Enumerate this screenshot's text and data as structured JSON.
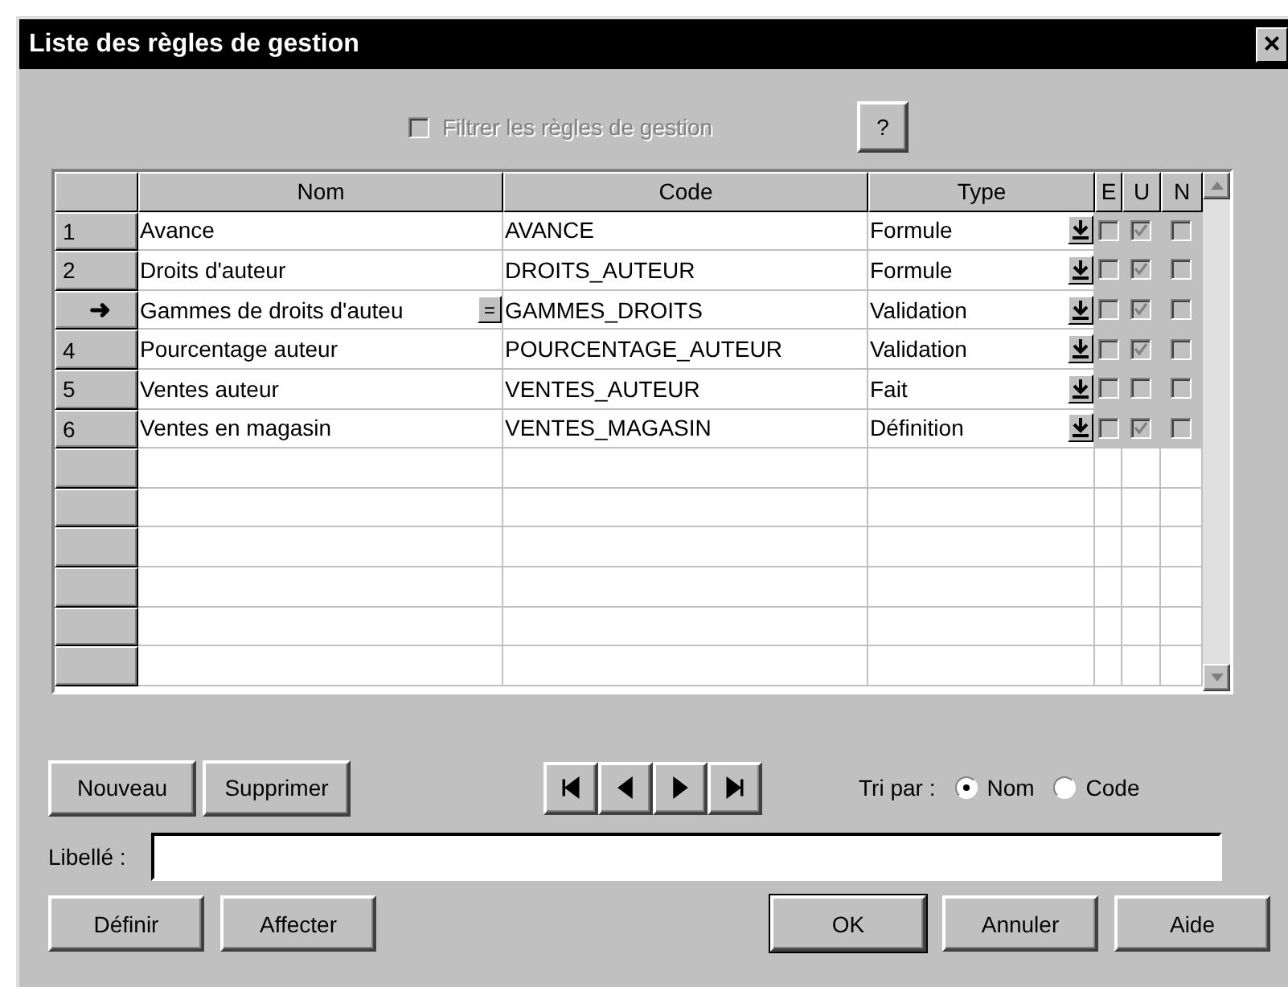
{
  "window": {
    "title": "Liste des règles de gestion",
    "close": "×"
  },
  "filter": {
    "label": "Filtrer les règles de gestion",
    "checked": false,
    "disabled": true
  },
  "help_button": "?",
  "table": {
    "columns": [
      "Nom",
      "Code",
      "Type",
      "E",
      "U",
      "N"
    ],
    "rows": [
      {
        "marker": "1",
        "selected": false,
        "nom": "Avance",
        "code": "AVANCE",
        "type": "Formule",
        "e": false,
        "u": true,
        "n": false
      },
      {
        "marker": "2",
        "selected": false,
        "nom": "Droits d'auteur",
        "code": "DROITS_AUTEUR",
        "type": "Formule",
        "e": false,
        "u": true,
        "n": false
      },
      {
        "marker": "➜",
        "selected": true,
        "nom": "Gammes de droits d'auteu",
        "edit_button": "=",
        "code": "GAMMES_DROITS",
        "type": "Validation",
        "e": false,
        "u": true,
        "n": false
      },
      {
        "marker": "4",
        "selected": false,
        "nom": "Pourcentage auteur",
        "code": "POURCENTAGE_AUTEUR",
        "type": "Validation",
        "e": false,
        "u": true,
        "n": false
      },
      {
        "marker": "5",
        "selected": false,
        "nom": "Ventes auteur",
        "code": "VENTES_AUTEUR",
        "type": "Fait",
        "e": false,
        "u": false,
        "n": false
      },
      {
        "marker": "6",
        "selected": false,
        "nom": "Ventes en magasin",
        "code": "VENTES_MAGASIN",
        "type": "Définition",
        "e": false,
        "u": true,
        "n": false
      }
    ]
  },
  "buttons_left": [
    "Nouveau",
    "Supprimer"
  ],
  "nav_buttons": [
    {
      "kind": "first"
    },
    {
      "kind": "prev"
    },
    {
      "kind": "next"
    },
    {
      "kind": "last"
    }
  ],
  "sort": {
    "label": "Tri par :",
    "options": [
      {
        "label": "Nom",
        "selected": true
      },
      {
        "label": "Code",
        "selected": false
      }
    ]
  },
  "libelle": {
    "label": "Libellé :"
  },
  "buttons_bottom_left": [
    "Définir",
    "Affecter"
  ],
  "buttons_bottom_right": [
    {
      "label": "OK",
      "default": true
    },
    {
      "label": "Annuler",
      "default": false
    },
    {
      "label": "Aide",
      "default": false
    }
  ]
}
